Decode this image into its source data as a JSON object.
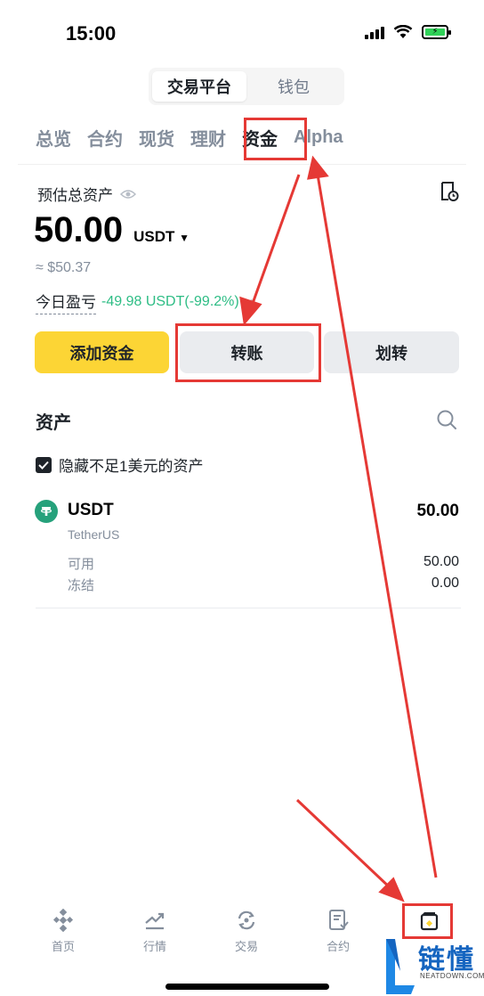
{
  "status_bar": {
    "time": "15:00"
  },
  "segment": {
    "items": [
      "交易平台",
      "钱包"
    ],
    "active": "交易平台"
  },
  "tabs": [
    "总览",
    "合约",
    "现货",
    "理财",
    "资金",
    "Alpha"
  ],
  "active_tab": "资金",
  "overview": {
    "estimated_label": "预估总资产",
    "balance": "50.00",
    "unit": "USDT",
    "approx": "≈ $50.37",
    "pnl_label": "今日盈亏",
    "pnl_value": "-49.98 USDT(-99.2",
    "pnl_value_tail": "%)"
  },
  "actions": {
    "add_funds": "添加资金",
    "transfer": "转账",
    "move": "划转"
  },
  "assets": {
    "title": "资产",
    "hide_small_label": "隐藏不足1美元的资产",
    "items": [
      {
        "symbol": "USDT",
        "name": "TetherUS",
        "amount": "50.00",
        "available_label": "可用",
        "available": "50.00",
        "frozen_label": "冻结",
        "frozen": "0.00"
      }
    ]
  },
  "bottom_nav": [
    "首页",
    "行情",
    "交易",
    "合约"
  ],
  "watermark": {
    "main": "链懂",
    "sub": "NEATDOWN.COM"
  },
  "colors": {
    "accent": "#fcd535",
    "gain": "#2ebd85",
    "annotation": "#e53935",
    "text": "#1e2329",
    "muted": "#848e9c"
  }
}
